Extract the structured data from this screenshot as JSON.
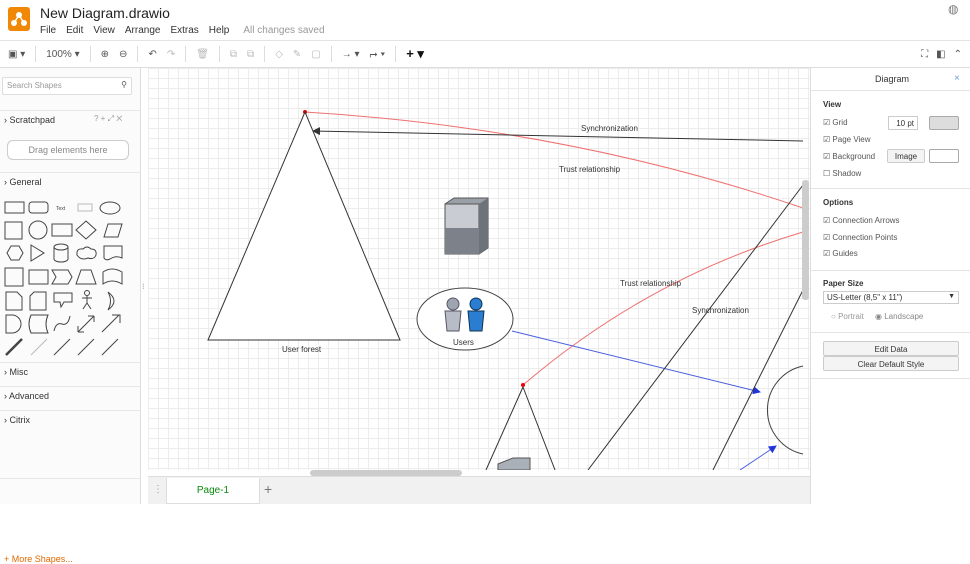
{
  "app": {
    "title": "New Diagram.drawio",
    "status": "All changes saved",
    "brand_color": "#f08705"
  },
  "menu": [
    "File",
    "Edit",
    "View",
    "Arrange",
    "Extras",
    "Help"
  ],
  "toolbar": {
    "zoom": "100%"
  },
  "sidebar": {
    "search_placeholder": "Search Shapes",
    "scratchpad": "Scratchpad",
    "scratchpad_icons": "? + ⤢ ✕",
    "drag_hint": "Drag elements here",
    "general": "General",
    "shape_text": "Text",
    "misc": "Misc",
    "advanced": "Advanced",
    "citrix": "Citrix",
    "more_shapes": "+ More Shapes..."
  },
  "diagram": {
    "labels": {
      "user_forest": "User forest",
      "users": "Users",
      "sync1": "Synchronization",
      "trust1": "Trust relationship",
      "trust2": "Trust relationship",
      "sync2": "Synchronization"
    },
    "colors": {
      "trust": "#f07070",
      "sync": "#333333",
      "link": "#4a5fe0"
    }
  },
  "pages": {
    "tab": "Page-1",
    "add": "+"
  },
  "panel": {
    "title": "Diagram",
    "view": "View",
    "grid": "Grid",
    "grid_size": "10 pt",
    "page_view": "Page View",
    "background": "Background",
    "image_btn": "Image",
    "shadow": "Shadow",
    "options": "Options",
    "connection_arrows": "Connection Arrows",
    "connection_points": "Connection Points",
    "guides": "Guides",
    "paper_size": "Paper Size",
    "paper_value": "US-Letter (8,5\" x 11\")",
    "portrait": "Portrait",
    "landscape": "Landscape",
    "orientation": "Landscape",
    "edit_data": "Edit Data",
    "clear_style": "Clear Default Style",
    "checks": {
      "grid": true,
      "page_view": true,
      "background": true,
      "shadow": false,
      "connection_arrows": true,
      "connection_points": true,
      "guides": true
    }
  }
}
